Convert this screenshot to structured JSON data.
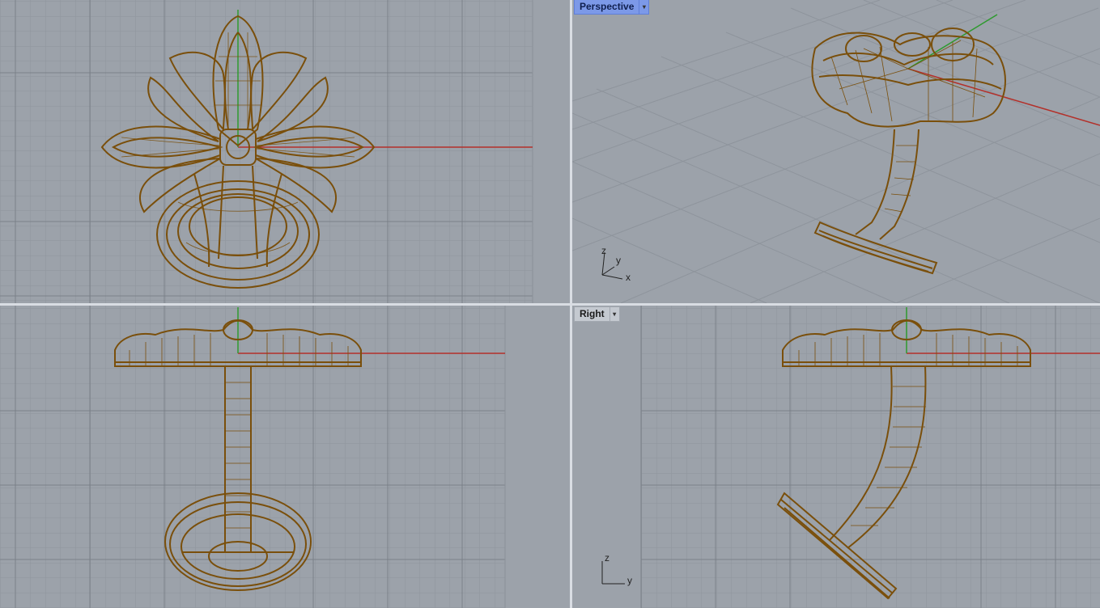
{
  "viewports": {
    "top": {
      "label": ""
    },
    "perspective": {
      "label": "Perspective",
      "menu_glyph": "▾",
      "active": true
    },
    "front": {
      "label": ""
    },
    "right": {
      "label": "Right",
      "menu_glyph": "▾"
    }
  },
  "axis_icons": {
    "perspective": {
      "z": "z",
      "y": "y",
      "x": "x"
    },
    "right": {
      "z": "z",
      "y": "y"
    }
  },
  "colors": {
    "viewport_bg": "#9ca2aa",
    "grid_minor": "#8e949c",
    "grid_major": "#7b8189",
    "x_axis": "#b3302a",
    "y_axis": "#2e9a2e",
    "wire": "#7a4f0b",
    "active_label": "#7c99e8"
  },
  "icons": {
    "viewport_menu": "chevron-down-icon",
    "axis_gizmo": "axis-triad-icon"
  }
}
